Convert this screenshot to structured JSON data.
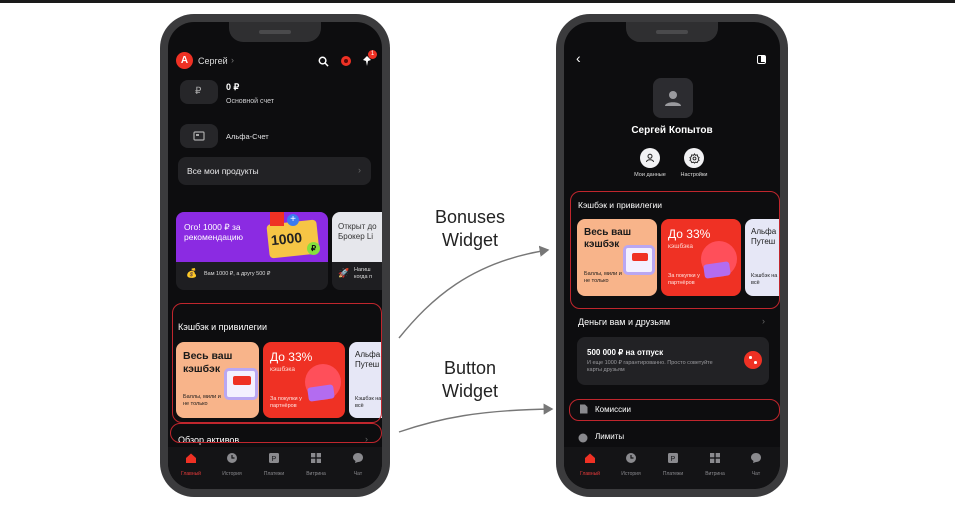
{
  "left_phone": {
    "header": {
      "name": "Сергей",
      "chevron": "›",
      "badge_count": "1"
    },
    "accounts": [
      {
        "title": "0 ₽",
        "subtitle": "Основной счет",
        "icon": "ruble-icon"
      },
      {
        "title": "Альфа-Счет",
        "subtitle": "",
        "icon": "card-icon"
      }
    ],
    "all_products": "Все мои продукты",
    "promo": {
      "title": "Ого! 1000 ₽ за рекомендацию",
      "bottom_text": "Вам 1000 ₽, а другу 500 ₽",
      "ticket_number": "1000",
      "second_title": "Открыт до Брокер Li",
      "second_bottom": "Нагиш когда п"
    },
    "cashback": {
      "title": "Кэшбэк и привилегии",
      "cards": [
        {
          "title": "Весь ваш кэшбэк",
          "subtitle": "Баллы, мили и не только"
        },
        {
          "title": "До 33%",
          "tag": "кэшбэка",
          "subtitle": "За покупки у партнёров"
        },
        {
          "title": "Альфа Путеш",
          "subtitle": "Кэшбэк на всё"
        }
      ]
    },
    "assets": "Обзор активов"
  },
  "right_phone": {
    "profile_name": "Сергей Копытов",
    "actions": [
      {
        "label": "Мои данные",
        "icon": "person-icon"
      },
      {
        "label": "Настройки",
        "icon": "gear-icon"
      }
    ],
    "cashback": {
      "title": "Кэшбэк и привилегии",
      "cards": [
        {
          "title": "Весь ваш кэшбэк",
          "subtitle": "Баллы, мили и не только"
        },
        {
          "title": "До 33%",
          "tag": "кэшбэка",
          "subtitle": "За покупки у партнёров"
        },
        {
          "title": "Альфа Путеш",
          "subtitle": "Кэшбэк на всё"
        }
      ]
    },
    "friends_section": "Деньги вам и друзьям",
    "vacation_card": {
      "title": "500 000 ₽ на отпуск",
      "subtitle": "И еще 1000 ₽ гарантированно. Просто советуйте карты друзьям"
    },
    "commissions": "Комиссии",
    "limits": "Лимиты"
  },
  "nav": [
    {
      "label": "Главный",
      "icon": "home-icon"
    },
    {
      "label": "История",
      "icon": "clock-icon"
    },
    {
      "label": "Платежи",
      "icon": "payment-icon"
    },
    {
      "label": "Витрина",
      "icon": "grid-icon"
    },
    {
      "label": "Чат",
      "icon": "chat-icon"
    }
  ],
  "captions": {
    "bonuses": "Bonuses Widget",
    "button": "Button Widget"
  },
  "colors": {
    "accent": "#ef3124",
    "annotation": "#c0262d",
    "purple": "#8b2be2",
    "peach": "#f8b48a",
    "red_card": "#ef3124"
  }
}
